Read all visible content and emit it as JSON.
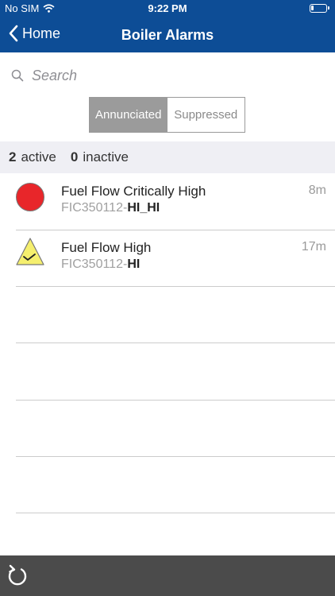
{
  "status_bar": {
    "carrier": "No SIM",
    "time": "9:22 PM",
    "battery_level": 0.2
  },
  "nav": {
    "back_label": "Home",
    "title": "Boiler Alarms"
  },
  "search": {
    "placeholder": "Search"
  },
  "segments": {
    "annunciated": "Annunciated",
    "suppressed": "Suppressed",
    "selected": "Annunciated"
  },
  "counts": {
    "active_count": "2",
    "active_label": "active",
    "inactive_count": "0",
    "inactive_label": "inactive"
  },
  "alarms": [
    {
      "title": "Fuel Flow Critically High",
      "tag_prefix": "FIC350112-",
      "tag_level": "HI_HI",
      "age": "8m",
      "icon": "critical-alarm-icon",
      "color": "#e8262a"
    },
    {
      "title": "Fuel Flow High",
      "tag_prefix": "FIC350112-",
      "tag_level": "HI",
      "age": "17m",
      "icon": "warning-acknowledged-icon",
      "color": "#f5ef6e"
    }
  ],
  "colors": {
    "nav": "#0d4d96",
    "toolbar": "#4b4b4b",
    "segment_active": "#9b9b9b"
  }
}
